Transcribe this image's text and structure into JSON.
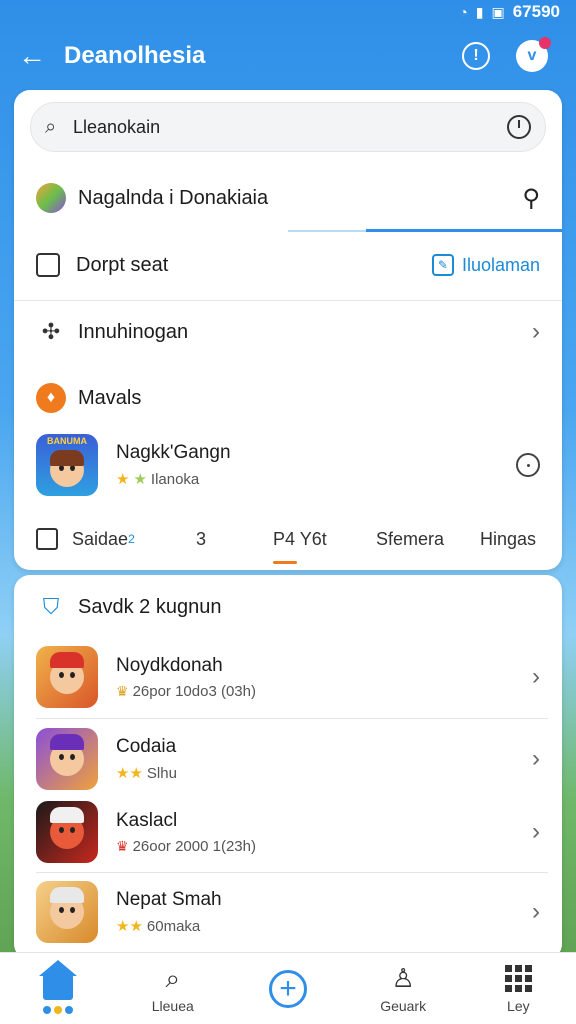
{
  "status": {
    "time": "67590"
  },
  "header": {
    "title": "Deanolhesia",
    "back_icon": "back-arrow-icon",
    "alert_icon": "alert-icon",
    "profile_icon": "profile-icon"
  },
  "search": {
    "value": "Lleanokain",
    "placeholder": ""
  },
  "menu": {
    "featured": "Nagalnda i Donakiaia",
    "doc": "Dorpt seat",
    "doc_link": "Iluolaman",
    "hub": "Innuhinogan",
    "section": "Mavals"
  },
  "featured_game": {
    "title": "Nagkk'Gangn",
    "sub": "Ilanoka",
    "thumb_text": "BANUMA"
  },
  "filters": {
    "first": "Saidae",
    "superscript": "2",
    "count": "3",
    "active": "P4 Y6t",
    "third": "Sfemera",
    "fourth": "Hingas"
  },
  "list_section": {
    "title": "Savdk 2 kugnun"
  },
  "games": [
    {
      "title": "Noydkdonah",
      "sub": "26por 10do3 (03h)"
    },
    {
      "title": "Codaia",
      "sub": "Slhu"
    },
    {
      "title": "Kaslacl",
      "sub": "26oor 2000 1(23h)"
    },
    {
      "title": "Nepat Smah",
      "sub": "60maka"
    }
  ],
  "nav": [
    {
      "label": ""
    },
    {
      "label": "Lleuea"
    },
    {
      "label": ""
    },
    {
      "label": "Geuark"
    },
    {
      "label": "Ley"
    }
  ],
  "colors": {
    "accent": "#2f8fe8",
    "star": "#f2b51e",
    "active_tab": "#f07a1e"
  }
}
